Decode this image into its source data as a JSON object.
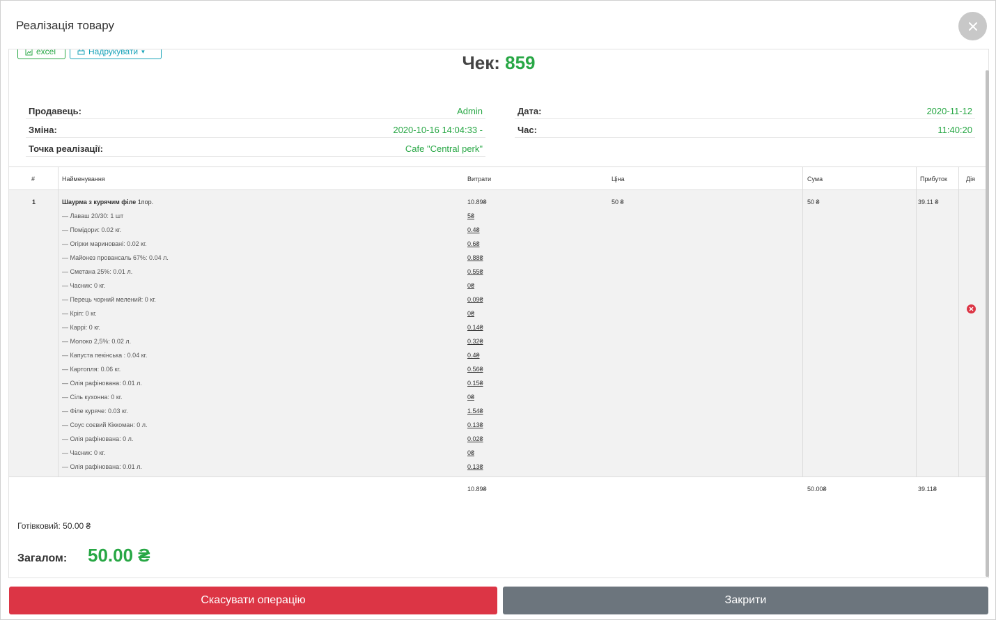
{
  "modal": {
    "title": "Реалізація товару"
  },
  "toolbar": {
    "excel_label": "excel",
    "print_label": "Надрукувати"
  },
  "check": {
    "label": "Чек:",
    "number": "859"
  },
  "info": {
    "seller_label": "Продавець:",
    "seller_value": "Admin",
    "shift_label": "Зміна:",
    "shift_value": "2020-10-16 14:04:33 -",
    "point_label": "Точка реалізації:",
    "point_value": "Cafe \"Central perk\"",
    "date_label": "Дата:",
    "date_value": "2020-11-12",
    "time_label": "Час:",
    "time_value": "11:40:20"
  },
  "table": {
    "headers": {
      "num": "#",
      "name": "Найменування",
      "cost": "Витрати",
      "price": "Ціна",
      "sum": "Сума",
      "profit": "Прибуток",
      "action": "Дія"
    },
    "row": {
      "num": "1",
      "name": "Шаурма з курячим філе",
      "portion": "1пор.",
      "cost": "10.89₴",
      "price": "50 ₴",
      "sum": "50 ₴",
      "profit": "39.11 ₴",
      "ingredients": [
        {
          "name": "Лаваш 20/30: 1 шт",
          "cost": "5₴"
        },
        {
          "name": "Помідори: 0.02 кг.",
          "cost": "0.4₴"
        },
        {
          "name": "Огірки мариновані: 0.02 кг.",
          "cost": "0.6₴"
        },
        {
          "name": "Майонез провансаль 67%: 0.04 л.",
          "cost": "0.88₴"
        },
        {
          "name": "Сметана 25%: 0.01 л.",
          "cost": "0.55₴"
        },
        {
          "name": "Часник: 0 кг.",
          "cost": "0₴"
        },
        {
          "name": "Перець чорний мелений: 0 кг.",
          "cost": "0.09₴"
        },
        {
          "name": "Кріп: 0 кг.",
          "cost": "0₴"
        },
        {
          "name": "Каррі: 0 кг.",
          "cost": "0.14₴"
        },
        {
          "name": "Молоко 2,5%: 0.02 л.",
          "cost": "0.32₴"
        },
        {
          "name": "Капуста пекінська : 0.04 кг.",
          "cost": "0.4₴"
        },
        {
          "name": "Картопля: 0.06 кг.",
          "cost": "0.56₴"
        },
        {
          "name": "Олія рафінована: 0.01 л.",
          "cost": "0.15₴"
        },
        {
          "name": "Сіль кухонна: 0 кг.",
          "cost": "0₴"
        },
        {
          "name": "Філе куряче: 0.03 кг.",
          "cost": "1.54₴"
        },
        {
          "name": "Соус соєвий Кіккоман: 0 л.",
          "cost": "0.13₴"
        },
        {
          "name": "Олія рафінована: 0 л.",
          "cost": "0.02₴"
        },
        {
          "name": "Часник: 0 кг.",
          "cost": "0₴"
        },
        {
          "name": "Олія рафінована: 0.01 л.",
          "cost": "0.13₴"
        }
      ]
    },
    "totals": {
      "cost": "10.89₴",
      "sum": "50.00₴",
      "profit": "39.11₴"
    }
  },
  "payment": {
    "cash": "Готівковий: 50.00 ₴",
    "total_label": "Загалом:",
    "total_value": "50.00 ₴"
  },
  "footer": {
    "cancel_label": "Скасувати операцію",
    "close_label": "Закрити"
  }
}
